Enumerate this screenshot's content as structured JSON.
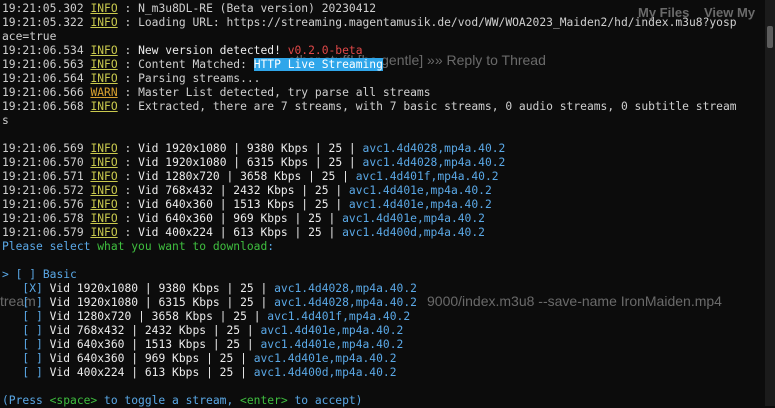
{
  "background": {
    "my_files": "My Files",
    "view_my": "View My",
    "reply_text": "other stuff! [be gentle]  »»  Reply to Thread",
    "cmd_text": "9000/index.m3u8 --save-name IronMaiden.mp4",
    "cmd_left": "tream"
  },
  "log": [
    {
      "ts": "19:21:05.302",
      "level": "INFO",
      "msg": "N_m3u8DL-RE (Beta version) 20230412"
    },
    {
      "ts": "19:21:05.322",
      "level": "INFO",
      "msg": "Loading URL: https://streaming.magentamusik.de/vod/WW/WOA2023_Maiden2/hd/index.m3u8?yosp"
    },
    {
      "cont": "ace=true"
    },
    {
      "ts": "19:21:06.534",
      "level": "INFO",
      "msg_white": "New version detected! ",
      "msg_red": "v0.2.0-beta"
    },
    {
      "ts": "19:21:06.563",
      "level": "INFO",
      "msg": "Content Matched: ",
      "highlight": "HTTP Live Streaming"
    },
    {
      "ts": "19:21:06.564",
      "level": "INFO",
      "msg": "Parsing streams..."
    },
    {
      "ts": "19:21:06.566",
      "level": "WARN",
      "msg": "Master List detected, try parse all streams"
    },
    {
      "ts": "19:21:06.568",
      "level": "INFO",
      "msg": "Extracted, there are 7 streams, with 7 basic streams, 0 audio streams, 0 subtitle stream"
    },
    {
      "cont": "s"
    }
  ],
  "streams": [
    {
      "ts": "19:21:06.569",
      "level": "INFO",
      "res": "1920x1080",
      "rest": " | 9380 Kbps | 25 | ",
      "codec": "avc1.4d4028,mp4a.40.2"
    },
    {
      "ts": "19:21:06.570",
      "level": "INFO",
      "res": "1920x1080",
      "rest": " | 6315 Kbps | 25 | ",
      "codec": "avc1.4d4028,mp4a.40.2"
    },
    {
      "ts": "19:21:06.571",
      "level": "INFO",
      "res": "1280x720",
      "rest": " | 3658 Kbps | 25 | ",
      "codec": "avc1.4d401f,mp4a.40.2"
    },
    {
      "ts": "19:21:06.572",
      "level": "INFO",
      "res": "768x432",
      "rest": " | 2432 Kbps | 25 | ",
      "codec": "avc1.4d401e,mp4a.40.2"
    },
    {
      "ts": "19:21:06.576",
      "level": "INFO",
      "res": "640x360",
      "rest": " | 1513 Kbps | 25 | ",
      "codec": "avc1.4d401e,mp4a.40.2"
    },
    {
      "ts": "19:21:06.578",
      "level": "INFO",
      "res": "640x360",
      "rest": " | 969 Kbps | 25 | ",
      "codec": "avc1.4d401e,mp4a.40.2"
    },
    {
      "ts": "19:21:06.579",
      "level": "INFO",
      "res": "400x224",
      "rest": " | 613 Kbps | 25 | ",
      "codec": "avc1.4d400d,mp4a.40.2"
    }
  ],
  "prompt": {
    "before": "Please select ",
    "green": "what you want to download",
    "after": ":"
  },
  "selection": {
    "cursor": ">",
    "group_box": "[ ]",
    "group_label": "Basic",
    "items": [
      {
        "box": "[X]",
        "res": "1920x1080",
        "rest": " | 9380 Kbps | 25 | ",
        "codec": "avc1.4d4028,mp4a.40.2"
      },
      {
        "box": "[ ]",
        "res": "1920x1080",
        "rest": " | 6315 Kbps | 25 | ",
        "codec": "avc1.4d4028,mp4a.40.2"
      },
      {
        "box": "[ ]",
        "res": "1280x720",
        "rest": " | 3658 Kbps | 25 | ",
        "codec": "avc1.4d401f,mp4a.40.2"
      },
      {
        "box": "[ ]",
        "res": "768x432",
        "rest": " | 2432 Kbps | 25 | ",
        "codec": "avc1.4d401e,mp4a.40.2"
      },
      {
        "box": "[ ]",
        "res": "640x360",
        "rest": " | 1513 Kbps | 25 | ",
        "codec": "avc1.4d401e,mp4a.40.2"
      },
      {
        "box": "[ ]",
        "res": "640x360",
        "rest": " | 969 Kbps | 25 | ",
        "codec": "avc1.4d401e,mp4a.40.2"
      },
      {
        "box": "[ ]",
        "res": "400x224",
        "rest": " | 613 Kbps | 25 | ",
        "codec": "avc1.4d400d,mp4a.40.2"
      }
    ]
  },
  "help": {
    "p1": "(Press ",
    "key1": "<space>",
    "p2": " to toggle a stream, ",
    "key2": "<enter>",
    "p3": " to accept)"
  },
  "vid_label": "Vid ",
  "sep": " : ",
  "colors": {
    "background": "#0c0c0c",
    "info": "#c9c94d",
    "warn": "#d9a02f",
    "green": "#3fbf3f",
    "highlight": "#2fa6ea",
    "codec": "#5aa8e6",
    "red": "#e04848"
  }
}
